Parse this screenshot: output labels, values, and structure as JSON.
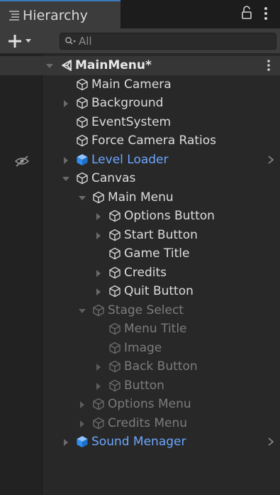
{
  "window": {
    "tab_title": "Hierarchy",
    "tab_icon": "hierarchy-list-icon",
    "lock_icon": "lock-icon",
    "menu_icon": "kebab-menu-icon"
  },
  "toolbar": {
    "add_icon": "plus-icon",
    "dropdown_icon": "caret-down-icon",
    "search_icon": "search-icon",
    "search_placeholder": "All",
    "search_value": ""
  },
  "colors": {
    "prefab": "#6ba7ff",
    "text": "#dcdcdc",
    "inactive": "#7c7c7c",
    "selection_accent": "#3a79bb"
  },
  "tree": [
    {
      "label": "MainMenu*",
      "depth": 0,
      "arrow": "expanded",
      "icon": "unity-scene-icon",
      "state": "scene",
      "kebab": true
    },
    {
      "label": "Main Camera",
      "depth": 1,
      "arrow": "none",
      "icon": "gameobject-cube-icon",
      "state": "normal"
    },
    {
      "label": "Background",
      "depth": 1,
      "arrow": "collapsed",
      "icon": "gameobject-cube-icon",
      "state": "normal"
    },
    {
      "label": "EventSystem",
      "depth": 1,
      "arrow": "none",
      "icon": "gameobject-cube-icon",
      "state": "normal"
    },
    {
      "label": "Force Camera Ratios",
      "depth": 1,
      "arrow": "none",
      "icon": "gameobject-cube-icon",
      "state": "normal"
    },
    {
      "label": "Level Loader",
      "depth": 1,
      "arrow": "collapsed",
      "icon": "prefab-cube-icon",
      "state": "prefab",
      "chevron": true,
      "gutter_icon": "hidden-eye-icon"
    },
    {
      "label": "Canvas",
      "depth": 1,
      "arrow": "expanded",
      "icon": "gameobject-cube-icon",
      "state": "normal"
    },
    {
      "label": "Main Menu",
      "depth": 2,
      "arrow": "expanded",
      "icon": "gameobject-cube-icon",
      "state": "normal"
    },
    {
      "label": "Options Button",
      "depth": 3,
      "arrow": "collapsed",
      "icon": "gameobject-cube-icon",
      "state": "normal"
    },
    {
      "label": "Start Button",
      "depth": 3,
      "arrow": "collapsed",
      "icon": "gameobject-cube-icon",
      "state": "normal"
    },
    {
      "label": "Game Title",
      "depth": 3,
      "arrow": "none",
      "icon": "gameobject-cube-icon",
      "state": "normal"
    },
    {
      "label": "Credits",
      "depth": 3,
      "arrow": "collapsed",
      "icon": "gameobject-cube-icon",
      "state": "normal"
    },
    {
      "label": "Quit Button",
      "depth": 3,
      "arrow": "collapsed",
      "icon": "gameobject-cube-icon",
      "state": "normal"
    },
    {
      "label": "Stage Select",
      "depth": 2,
      "arrow": "expanded",
      "icon": "gameobject-cube-icon",
      "state": "inactive"
    },
    {
      "label": "Menu Title",
      "depth": 3,
      "arrow": "none",
      "icon": "gameobject-cube-icon",
      "state": "inactive"
    },
    {
      "label": "Image",
      "depth": 3,
      "arrow": "none",
      "icon": "gameobject-cube-icon",
      "state": "inactive"
    },
    {
      "label": "Back  Button",
      "depth": 3,
      "arrow": "collapsed",
      "icon": "gameobject-cube-icon",
      "state": "inactive"
    },
    {
      "label": "Button",
      "depth": 3,
      "arrow": "collapsed",
      "icon": "gameobject-cube-icon",
      "state": "inactive"
    },
    {
      "label": "Options Menu",
      "depth": 2,
      "arrow": "collapsed",
      "icon": "gameobject-cube-icon",
      "state": "inactive"
    },
    {
      "label": "Credits Menu",
      "depth": 2,
      "arrow": "collapsed",
      "icon": "gameobject-cube-icon",
      "state": "inactive"
    },
    {
      "label": "Sound Menager",
      "depth": 1,
      "arrow": "collapsed",
      "icon": "prefab-cube-icon",
      "state": "prefab",
      "chevron": true
    }
  ]
}
